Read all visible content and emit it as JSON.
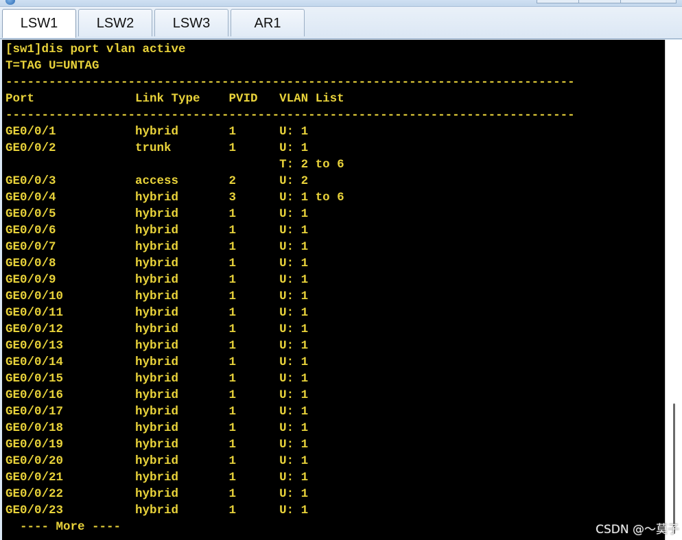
{
  "tabs": [
    {
      "label": "LSW1",
      "active": true
    },
    {
      "label": "LSW2",
      "active": false
    },
    {
      "label": "LSW3",
      "active": false
    },
    {
      "label": "AR1",
      "active": false
    }
  ],
  "terminal": {
    "command": "[sw1]dis port vlan active",
    "legend": "T=TAG U=UNTAG",
    "separator": "-------------------------------------------------------------------------------",
    "header": "Port              Link Type    PVID   VLAN List",
    "rows": [
      "GE0/0/1           hybrid       1      U: 1",
      "GE0/0/2           trunk        1      U: 1",
      "                                      T: 2 to 6",
      "GE0/0/3           access       2      U: 2",
      "GE0/0/4           hybrid       3      U: 1 to 6",
      "GE0/0/5           hybrid       1      U: 1",
      "GE0/0/6           hybrid       1      U: 1",
      "GE0/0/7           hybrid       1      U: 1",
      "GE0/0/8           hybrid       1      U: 1",
      "GE0/0/9           hybrid       1      U: 1",
      "GE0/0/10          hybrid       1      U: 1",
      "GE0/0/11          hybrid       1      U: 1",
      "GE0/0/12          hybrid       1      U: 1",
      "GE0/0/13          hybrid       1      U: 1",
      "GE0/0/14          hybrid       1      U: 1",
      "GE0/0/15          hybrid       1      U: 1",
      "GE0/0/16          hybrid       1      U: 1",
      "GE0/0/17          hybrid       1      U: 1",
      "GE0/0/18          hybrid       1      U: 1",
      "GE0/0/19          hybrid       1      U: 1",
      "GE0/0/20          hybrid       1      U: 1",
      "GE0/0/21          hybrid       1      U: 1",
      "GE0/0/22          hybrid       1      U: 1",
      "GE0/0/23          hybrid       1      U: 1"
    ],
    "more_prompt": "  ---- More ----"
  },
  "watermark": "CSDN @～莫子",
  "colors": {
    "terminal_bg": "#000000",
    "terminal_text": "#e8d23a"
  }
}
